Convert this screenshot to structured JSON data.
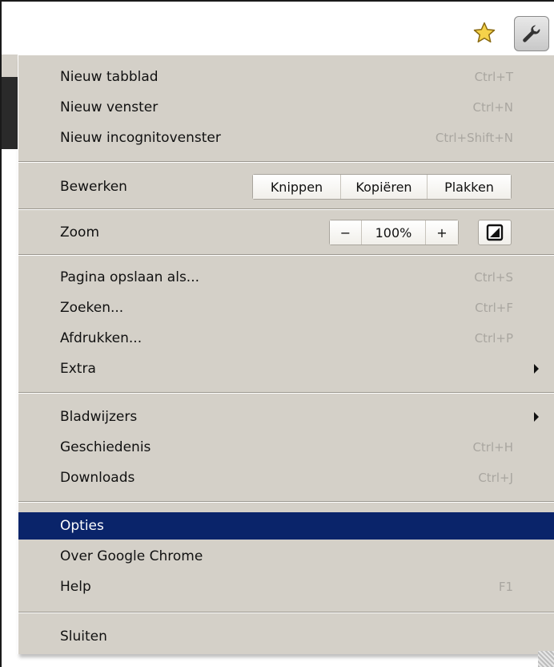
{
  "toolbar": {
    "star_icon": "bookmark-star-icon",
    "wrench_icon": "wrench-icon"
  },
  "menu": {
    "group1": [
      {
        "label": "Nieuw tabblad",
        "shortcut": "Ctrl+T"
      },
      {
        "label": "Nieuw venster",
        "shortcut": "Ctrl+N"
      },
      {
        "label": "Nieuw incognitovenster",
        "shortcut": "Ctrl+Shift+N"
      }
    ],
    "edit": {
      "label": "Bewerken",
      "cut": "Knippen",
      "copy": "Kopiëren",
      "paste": "Plakken"
    },
    "zoom": {
      "label": "Zoom",
      "minus": "−",
      "value": "100%",
      "plus": "+",
      "fullscreen_icon": "fullscreen-icon"
    },
    "group2": [
      {
        "label": "Pagina opslaan als...",
        "shortcut": "Ctrl+S"
      },
      {
        "label": "Zoeken...",
        "shortcut": "Ctrl+F"
      },
      {
        "label": "Afdrukken...",
        "shortcut": "Ctrl+P"
      },
      {
        "label": "Extra",
        "submenu": true
      }
    ],
    "group3": [
      {
        "label": "Bladwijzers",
        "submenu": true
      },
      {
        "label": "Geschiedenis",
        "shortcut": "Ctrl+H"
      },
      {
        "label": "Downloads",
        "shortcut": "Ctrl+J"
      }
    ],
    "group4": [
      {
        "label": "Opties",
        "selected": true
      },
      {
        "label": "Over Google Chrome"
      },
      {
        "label": "Help",
        "shortcut": "F1"
      }
    ],
    "group5": [
      {
        "label": "Sluiten"
      }
    ]
  },
  "colors": {
    "menu_bg": "#d4d0c8",
    "selection_bg": "#0a246a",
    "shortcut_text": "#a9a6a0"
  }
}
